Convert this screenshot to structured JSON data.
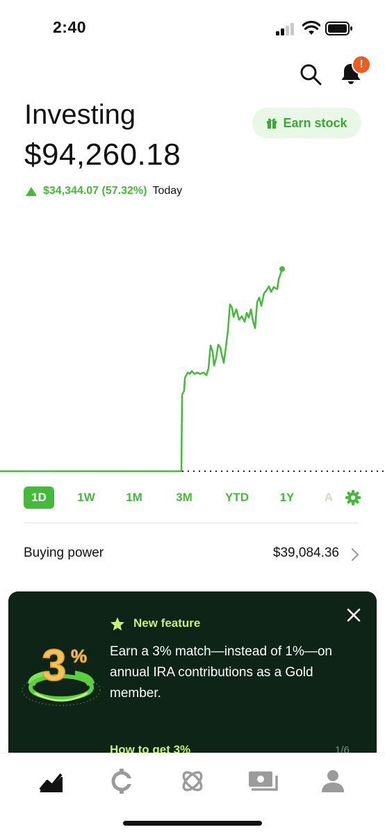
{
  "status_bar": {
    "time": "2:40"
  },
  "header": {
    "title": "Investing",
    "portfolio_value": "$94,260.18",
    "earn_stock_label": "Earn stock",
    "notification_badge": "!",
    "change_amount": "$34,344.07 (57.32%)",
    "change_period": "Today"
  },
  "range_selector": {
    "options": [
      "1D",
      "1W",
      "1M",
      "3M",
      "YTD",
      "1Y",
      "A"
    ],
    "selected": "1D"
  },
  "buying_power": {
    "label": "Buying power",
    "value": "$39,084.36"
  },
  "promo": {
    "tag": "New feature",
    "body": "Earn a 3% match—instead of 1%—on annual IRA contributions as a Gold member.",
    "link": "How to get 3%",
    "pager": "1/6",
    "art_text": "3%"
  },
  "tab_bar": {
    "items": [
      "investing-tab-icon",
      "crypto-tab-icon",
      "network-tab-icon",
      "cash-tab-icon",
      "account-tab-icon"
    ]
  },
  "colors": {
    "accent_green": "#44b93a",
    "promo_bg": "#0d2416",
    "promo_highlight": "#c6f36b",
    "badge": "#ee5a24"
  }
}
